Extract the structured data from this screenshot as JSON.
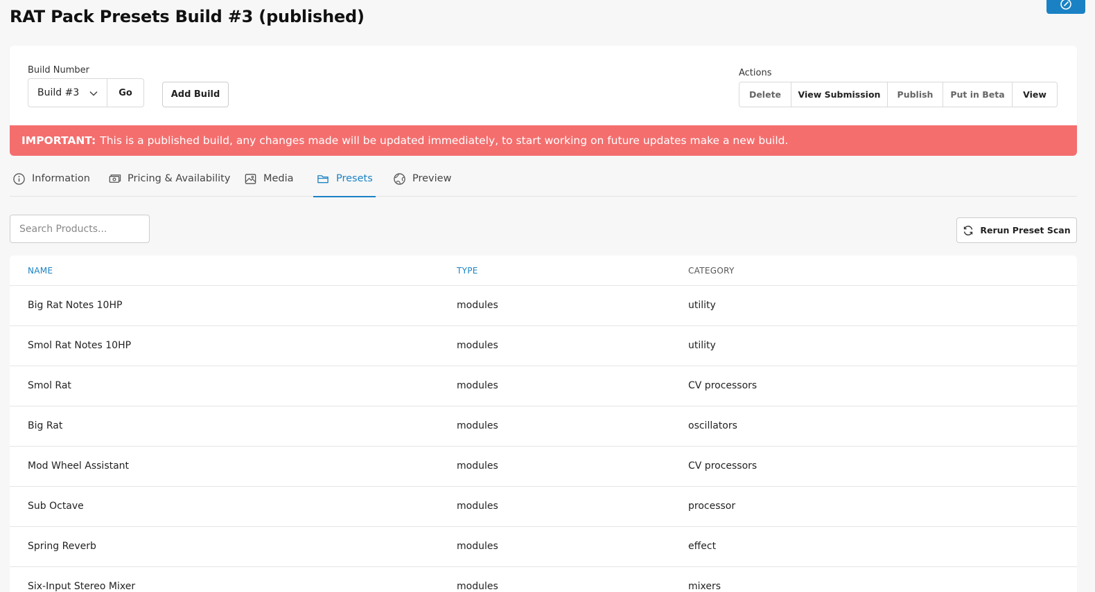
{
  "page": {
    "title": "RAT Pack Presets Build #3 (published)"
  },
  "build": {
    "label": "Build Number",
    "selected": "Build #3",
    "go_label": "Go",
    "add_label": "Add Build"
  },
  "actions": {
    "label": "Actions",
    "items": [
      {
        "label": "Delete"
      },
      {
        "label": "View Submission"
      },
      {
        "label": "Publish"
      },
      {
        "label": "Put in Beta"
      },
      {
        "label": "View"
      }
    ]
  },
  "alert": {
    "strong": "IMPORTANT:",
    "text": "This is a published build, any changes made will be updated immediately, to start working on future updates make a new build."
  },
  "tabs": [
    {
      "label": "Information",
      "icon": "info-icon"
    },
    {
      "label": "Pricing & Availability",
      "icon": "cash-icon"
    },
    {
      "label": "Media",
      "icon": "image-icon"
    },
    {
      "label": "Presets",
      "icon": "folder-icon",
      "active": true
    },
    {
      "label": "Preview",
      "icon": "globe-icon"
    }
  ],
  "search": {
    "placeholder": "Search Products..."
  },
  "rerun": {
    "label": "Rerun Preset Scan"
  },
  "table": {
    "columns": [
      "NAME",
      "TYPE",
      "CATEGORY"
    ],
    "rows": [
      [
        "Big Rat Notes 10HP",
        "modules",
        "utility"
      ],
      [
        "Smol Rat Notes 10HP",
        "modules",
        "utility"
      ],
      [
        "Smol Rat",
        "modules",
        "CV processors"
      ],
      [
        "Big Rat",
        "modules",
        "oscillators"
      ],
      [
        "Mod Wheel Assistant",
        "modules",
        "CV processors"
      ],
      [
        "Sub Octave",
        "modules",
        "processor"
      ],
      [
        "Spring Reverb",
        "modules",
        "effect"
      ],
      [
        "Six-Input Stereo Mixer",
        "modules",
        "mixers"
      ]
    ]
  },
  "colors": {
    "accent": "#1a82c4",
    "alert": "#f46e6e",
    "background": "#f7f7f7"
  }
}
